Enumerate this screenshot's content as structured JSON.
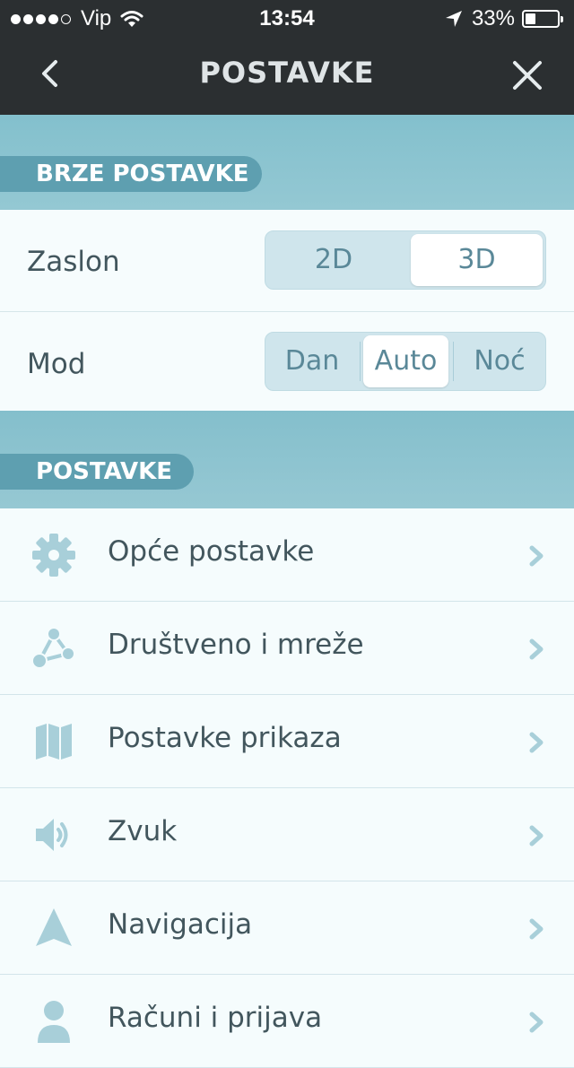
{
  "status_bar": {
    "carrier": "Vip",
    "time": "13:54",
    "battery": "33%",
    "battery_level": 0.33
  },
  "header": {
    "title": "POSTAVKE"
  },
  "quick_settings": {
    "title": "BRZE POSTAVKE",
    "display": {
      "label": "Zaslon",
      "options": [
        "2D",
        "3D"
      ],
      "selected": "3D"
    },
    "mode": {
      "label": "Mod",
      "options": [
        "Dan",
        "Auto",
        "Noć"
      ],
      "selected": "Auto"
    }
  },
  "settings": {
    "title": "POSTAVKE",
    "items": [
      {
        "label": "Opće postavke",
        "icon": "gear-icon"
      },
      {
        "label": "Društveno i mreže",
        "icon": "share-network-icon"
      },
      {
        "label": "Postavke prikaza",
        "icon": "map-icon"
      },
      {
        "label": "Zvuk",
        "icon": "speaker-icon"
      },
      {
        "label": "Navigacija",
        "icon": "navigation-arrow-icon"
      },
      {
        "label": "Računi i prijava",
        "icon": "user-icon"
      }
    ]
  },
  "colors": {
    "accent": "#5e9fb0",
    "icon": "#a8cfd9",
    "header_bg": "#2b2f31"
  }
}
